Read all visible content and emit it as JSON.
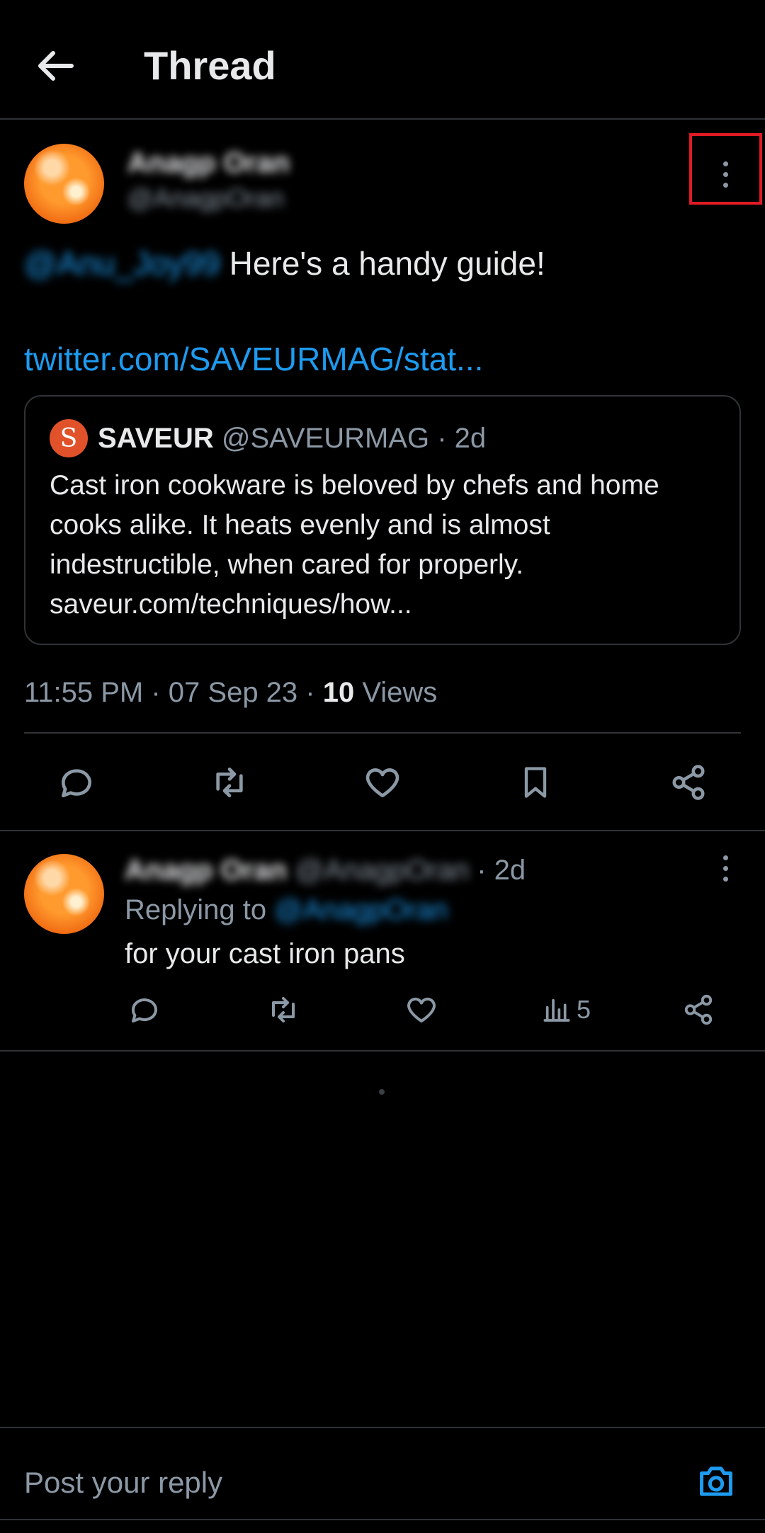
{
  "header": {
    "title": "Thread"
  },
  "main_tweet": {
    "author_name": "Anagp Oran",
    "author_handle": "@AnagpOran",
    "mention": "@Anu_Joy99",
    "text": " Here's a handy guide!",
    "link": "twitter.com/SAVEURMAG/stat...",
    "quote": {
      "avatar_letter": "S",
      "name": "SAVEUR",
      "meta": " @SAVEURMAG · 2d",
      "body": "Cast iron cookware is beloved by chefs and home cooks alike. It heats evenly and is almost indestructible, when cared for properly. saveur.com/techniques/how..."
    },
    "time": "11:55 PM · 07 Sep 23 · ",
    "views_count": "10",
    "views_label": " Views"
  },
  "reply": {
    "author_name": "Anagp Oran",
    "author_handle": "@AnagpOran",
    "age": " · 2d",
    "replying_prefix": "Replying to ",
    "replying_handle": "@AnagpOran",
    "text": "for your cast iron pans",
    "views": "5"
  },
  "composer": {
    "placeholder": "Post your reply"
  },
  "icons": {
    "back": "arrow-left-icon",
    "more": "more-vertical-icon",
    "reply": "comment-icon",
    "retweet": "retweet-icon",
    "like": "heart-icon",
    "bookmark": "bookmark-icon",
    "share": "share-icon",
    "views": "bar-chart-icon",
    "camera": "camera-icon"
  },
  "colors": {
    "accent": "#1d9bf0",
    "highlight": "#e01b23",
    "background": "#000000"
  }
}
